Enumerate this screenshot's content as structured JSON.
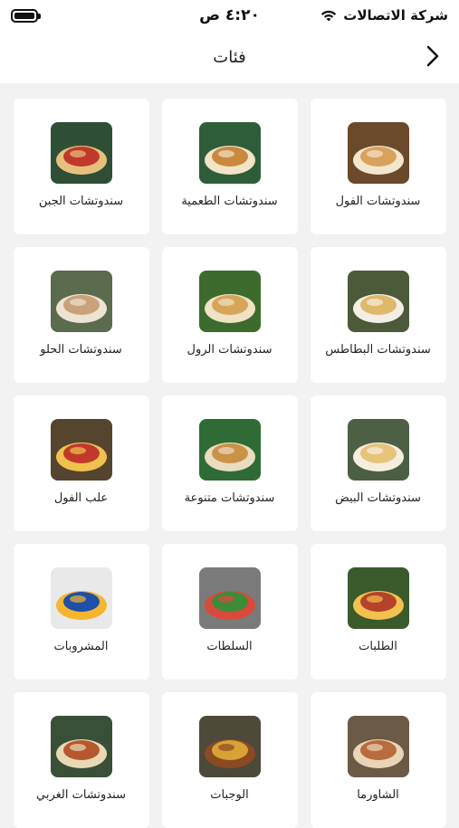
{
  "status_bar": {
    "carrier": "شركة الاتصالات",
    "time": "٤:٢٠ ص",
    "battery_level": 1.0
  },
  "header": {
    "title": "فئات",
    "back_icon": "chevron-right-icon"
  },
  "categories": [
    {
      "label": "سندوتشات الفول",
      "icon": "foul-sandwich-photo"
    },
    {
      "label": "سندوتشات الطعمية",
      "icon": "taameya-sandwich-photo"
    },
    {
      "label": "سندوتشات الجبن",
      "icon": "cheese-sandwich-photo"
    },
    {
      "label": "سندوتشات البطاطس",
      "icon": "potato-sandwich-photo"
    },
    {
      "label": "سندوتشات الرول",
      "icon": "roll-sandwich-photo"
    },
    {
      "label": "سندوتشات الحلو",
      "icon": "sweet-sandwich-photo"
    },
    {
      "label": "سندوتشات البيض",
      "icon": "egg-sandwich-photo"
    },
    {
      "label": "سندوتشات متنوعة",
      "icon": "assorted-sandwich-photo"
    },
    {
      "label": "علب الفول",
      "icon": "foul-box-photo"
    },
    {
      "label": "الطلبات",
      "icon": "orders-photo"
    },
    {
      "label": "السلطات",
      "icon": "salad-photo"
    },
    {
      "label": "المشروبات",
      "icon": "drinks-photo"
    },
    {
      "label": "الشاورما",
      "icon": "shawarma-photo"
    },
    {
      "label": "الوجبات",
      "icon": "meals-photo"
    },
    {
      "label": "سندوتشات الغربي",
      "icon": "western-sandwich-photo"
    }
  ]
}
